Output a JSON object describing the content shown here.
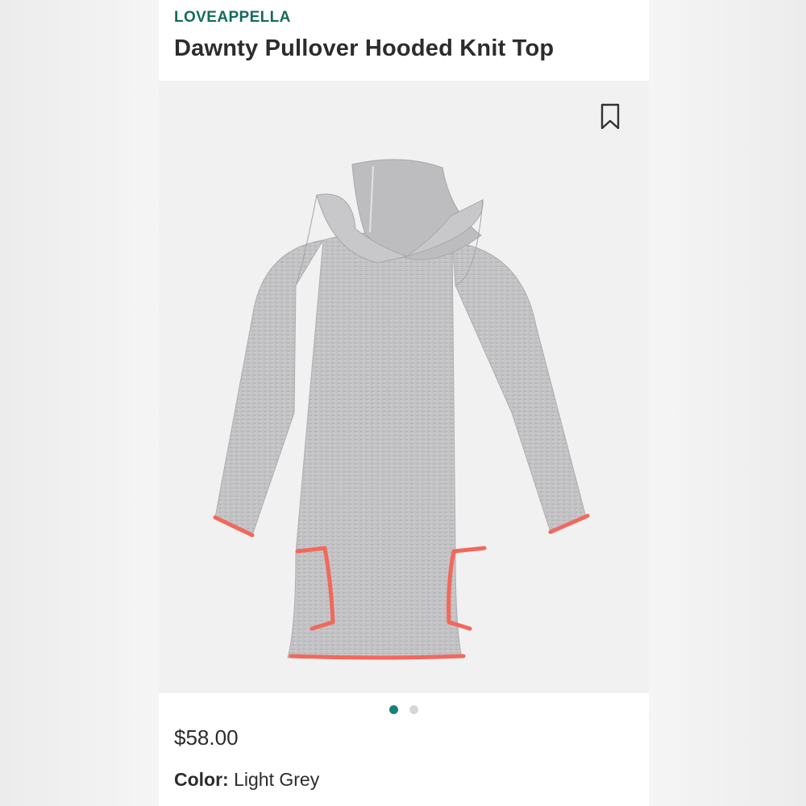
{
  "product": {
    "brand": "LOVEAPPELLA",
    "name": "Dawnty Pullover Hooded Knit Top",
    "price": "$58.00",
    "color_label": "Color:",
    "color_value": "Light Grey"
  },
  "gallery": {
    "image_count": 2,
    "active_index": 0
  },
  "icons": {
    "bookmark": "bookmark-icon"
  },
  "colors": {
    "brand": "#146b5c",
    "dot_active": "#17807a",
    "dot_inactive": "#d6d6d6",
    "garment_body": "#c2c2c4",
    "garment_trim": "#f2685c"
  }
}
